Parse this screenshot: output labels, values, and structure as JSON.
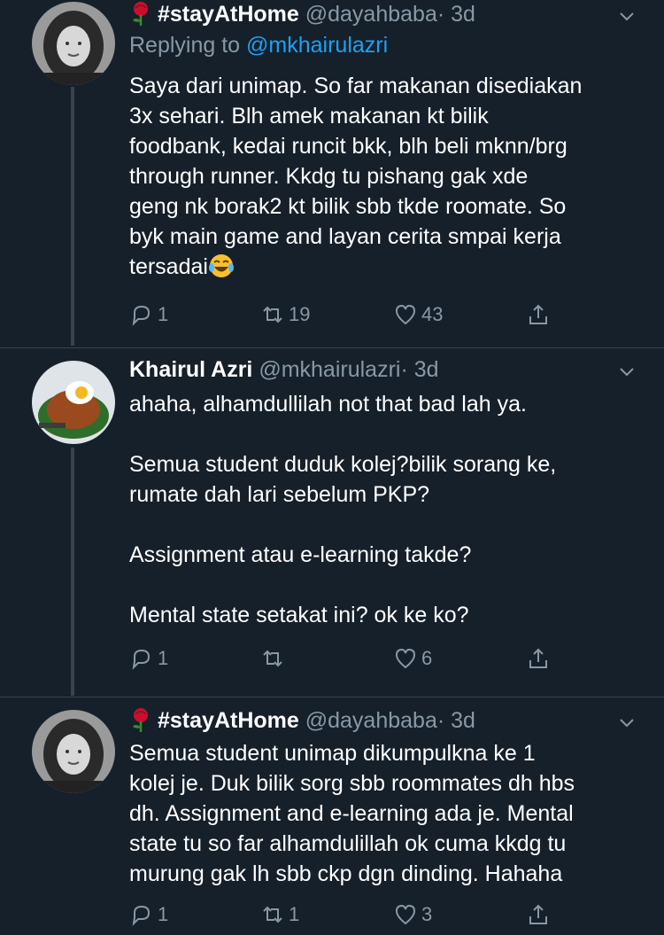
{
  "tweets": [
    {
      "name": "#stayAtHome",
      "handle": "@dayahbaba",
      "dot": "·",
      "time": "3d",
      "reply_prefix": "Replying to",
      "reply_to": "@mkhairulazri",
      "text": "Saya dari unimap. So far makanan disediakan\n3x sehari. Blh amek makanan kt bilik\nfoodbank, kedai runcit bkk, blh beli mknn/brg\nthrough runner. Kkdg tu pishang gak xde\ngeng nk borak2 kt bilik sbb tkde roomate. So\nbyk main game and layan cerita smpai kerja\ntersadai",
      "replies": "1",
      "retweets": "19",
      "likes": "43",
      "name_emoji": "rose-icon",
      "text_emoji": "laughing-tears-emoji"
    },
    {
      "name": "Khairul Azri",
      "handle": "@mkhairulazri",
      "dot": "·",
      "time": "3d",
      "text": "ahaha, alhamdullilah not that bad lah ya.\n\nSemua student duduk kolej?bilik sorang ke,\nrumate dah lari sebelum PKP?\n\nAssignment atau e-learning takde?\n\nMental state setakat ini? ok ke ko?",
      "replies": "1",
      "retweets": "",
      "likes": "6"
    },
    {
      "name": "#stayAtHome",
      "handle": "@dayahbaba",
      "dot": "·",
      "time": "3d",
      "text": "Semua student unimap dikumpulkna ke 1\nkolej je. Duk bilik sorg sbb roommates dh hbs\ndh. Assignment and e-learning ada je. Mental\nstate tu so far alhamdulillah ok cuma kkdg tu\nmurung gak lh sbb ckp dgn dinding. Hahaha",
      "replies": "1",
      "retweets": "1",
      "likes": "3",
      "name_emoji": "rose-icon"
    }
  ],
  "colors": {
    "background": "#15202b",
    "secondary_text": "#8899a6",
    "link": "#1da1f2",
    "thread_line": "#38444d"
  }
}
